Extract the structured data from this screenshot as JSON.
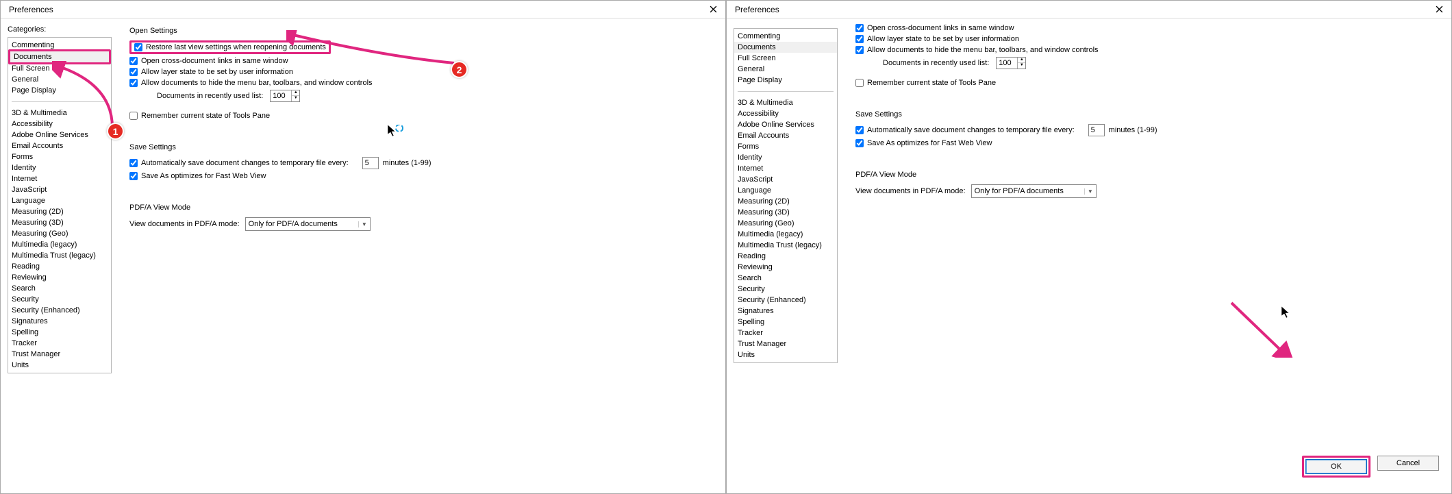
{
  "window_title": "Preferences",
  "categories_label": "Categories:",
  "categories_top": [
    "Commenting",
    "Documents",
    "Full Screen",
    "General",
    "Page Display"
  ],
  "categories_bottom": [
    "3D & Multimedia",
    "Accessibility",
    "Adobe Online Services",
    "Email Accounts",
    "Forms",
    "Identity",
    "Internet",
    "JavaScript",
    "Language",
    "Measuring (2D)",
    "Measuring (3D)",
    "Measuring (Geo)",
    "Multimedia (legacy)",
    "Multimedia Trust (legacy)",
    "Reading",
    "Reviewing",
    "Search",
    "Security",
    "Security (Enhanced)",
    "Signatures",
    "Spelling",
    "Tracker",
    "Trust Manager",
    "Units"
  ],
  "selected_category": "Documents",
  "open_settings": {
    "title": "Open Settings",
    "restore": "Restore last view settings when reopening documents",
    "cross_doc": "Open cross-document links in same window",
    "layer_state": "Allow layer state to be set by user information",
    "allow_hide": "Allow documents to hide the menu bar, toolbars, and window controls",
    "recent_label": "Documents in recently used list:",
    "recent_value": "100",
    "remember_tools": "Remember current state of Tools Pane"
  },
  "save_settings": {
    "title": "Save Settings",
    "auto_save": "Automatically save document changes to temporary file every:",
    "auto_value": "5",
    "minutes_label": "minutes (1-99)",
    "fast_web": "Save As optimizes for Fast Web View"
  },
  "pdfa": {
    "title": "PDF/A View Mode",
    "label": "View documents in PDF/A mode:",
    "value": "Only for PDF/A documents"
  },
  "buttons": {
    "ok": "OK",
    "cancel": "Cancel"
  },
  "annotations": {
    "badge1": "1",
    "badge2": "2"
  }
}
